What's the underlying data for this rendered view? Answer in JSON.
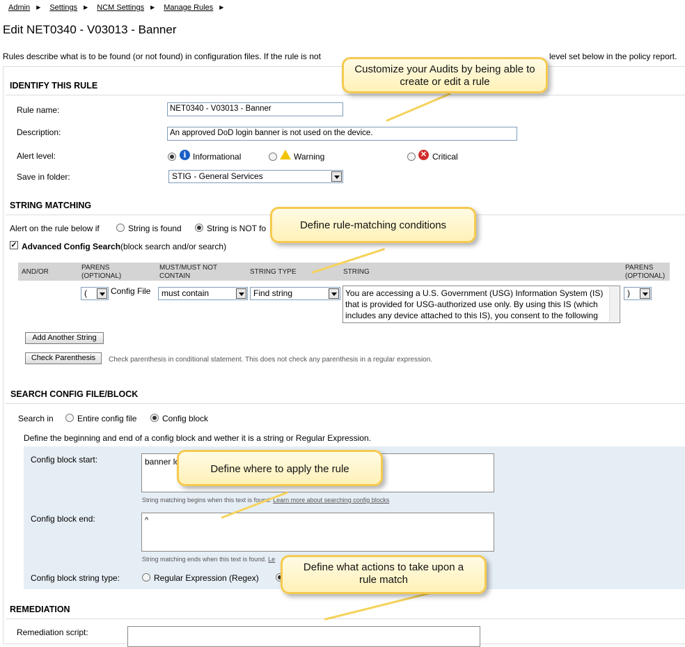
{
  "breadcrumb": [
    "Admin",
    "Settings",
    "NCM Settings",
    "Manage Rules"
  ],
  "page_title": "Edit NET0340 - V03013 - Banner",
  "intro": "Rules describe what is to be found (or not found) in configuration files. If the rule is not",
  "intro_tail": "level set below in the policy report.",
  "identify": {
    "heading": "IDENTIFY THIS RULE",
    "rule_name_label": "Rule name:",
    "rule_name_value": "NET0340 - V03013 - Banner",
    "description_label": "Description:",
    "description_value": "An approved DoD login banner is not used on the device.",
    "alert_level_label": "Alert level:",
    "alert_options": [
      "Informational",
      "Warning",
      "Critical"
    ],
    "alert_selected": "Informational",
    "folder_label": "Save in folder:",
    "folder_value": "STIG - General Services"
  },
  "string_matching": {
    "heading": "STRING MATCHING",
    "alert_label": "Alert on the rule below if",
    "opt_found": "String is found",
    "opt_not_found": "String is NOT fo",
    "selected": "String is NOT found",
    "advanced_label": "Advanced Config Search",
    "advanced_suffix": "(block search and/or search)",
    "advanced_checked": true,
    "columns": {
      "andor": "AND/OR",
      "parens1": [
        "PARENS",
        "(OPTIONAL)"
      ],
      "must": [
        "MUST/MUST NOT",
        "CONTAIN"
      ],
      "type": "STRING TYPE",
      "string": "STRING",
      "parens2": [
        "PARENS",
        "(OPTIONAL)"
      ]
    },
    "row": {
      "open_paren": "(",
      "config_file_label": "Config File",
      "must_value": "must contain",
      "type_value": "Find string",
      "string_value": "You are accessing a U.S. Government (USG) Information System (IS) that is provided for USG-authorized use only. By using this IS (which includes any device attached to this IS), you consent to the following conditions:",
      "close_paren": ")"
    },
    "add_button": "Add Another String",
    "check_button": "Check Parenthesis",
    "check_note": "Check parenthesis in conditional statement. This does not check any parenthesis in a regular expression."
  },
  "search_block": {
    "heading": "SEARCH CONFIG FILE/BLOCK",
    "search_in_label": "Search in",
    "opt_entire": "Entire config file",
    "opt_block": "Config block",
    "selected": "Config block",
    "define_text": "Define the beginning and end of a config block and wether it is a string or Regular Expression.",
    "start_label": "Config block start:",
    "start_value": "banner lo",
    "start_note": "String matching begins when this text is found.",
    "start_link": "Learn more about searching config blocks",
    "end_label": "Config block end:",
    "end_value": "^",
    "end_note": "String matching ends when this text is found.",
    "end_link": "Le",
    "string_type_label": "Config block string type:",
    "opt_regex": "Regular Expression (Regex)"
  },
  "remediation": {
    "heading": "REMEDIATION",
    "script_label": "Remediation script:"
  },
  "callouts": {
    "c1": "Customize your Audits by being able to create or edit a rule",
    "c2": "Define rule-matching conditions",
    "c3": "Define where to apply the rule",
    "c4": "Define what actions to take upon a rule match"
  },
  "colors": {
    "callout_fill": "#fff1b8",
    "callout_border": "#f5ca4f",
    "panel_bg": "#e6eef5",
    "grid_header": "#d4d4d4"
  }
}
